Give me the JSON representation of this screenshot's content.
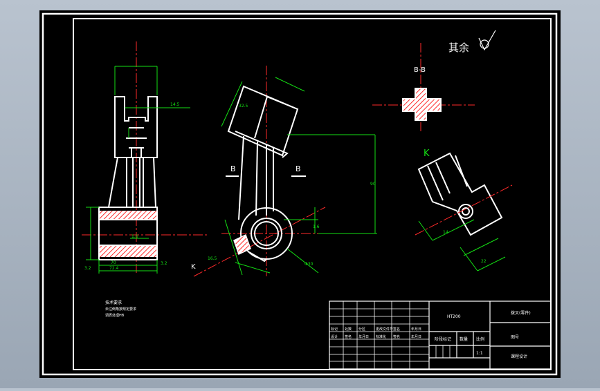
{
  "drawing": {
    "roughness_label": "其余",
    "section_label": "B-B",
    "cut_label_left": "B",
    "cut_label_right": "B",
    "view_label_k": "K",
    "view_arrow_k": "K"
  },
  "notes": {
    "heading": "技术要求",
    "line1": "未注倒角按规定要求",
    "line2": "调质处理HB"
  },
  "title_block": {
    "material": "HT200",
    "name": "拨叉(零件)",
    "drawing_no": "图号",
    "school": "课程设计",
    "scale_label": "比例",
    "qty_label": "数量",
    "sheet_count": "1:1",
    "row_labels": [
      "标记",
      "处数",
      "分区",
      "更改文件号",
      "签名",
      "年月日"
    ],
    "design_labels": [
      "设计",
      "签名",
      "年月日",
      "标准化",
      "签名",
      "年月日"
    ],
    "stage_label": "阶段标记"
  },
  "colors": {
    "sheet": "#000000",
    "line": "#ffffff",
    "center": "#ff2a2a",
    "dimension": "#14e014",
    "text_white": "#ffffff"
  }
}
